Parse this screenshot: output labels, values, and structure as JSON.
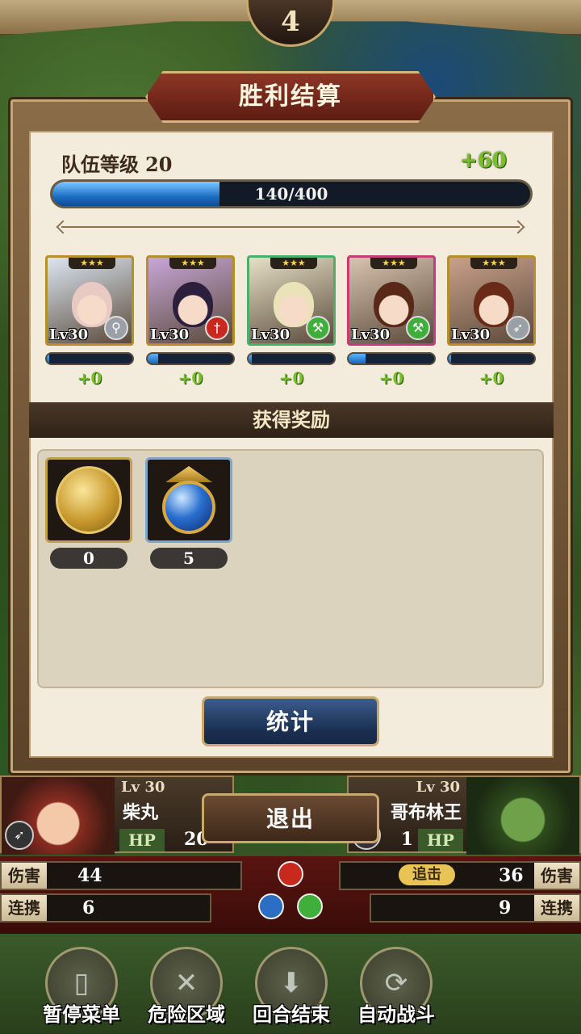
{
  "turn": {
    "number": "4"
  },
  "result": {
    "title": "胜利结算",
    "party_level_label": "队伍等级",
    "party_level": "20",
    "exp_gain": "+60",
    "exp_text": "140/400",
    "exp_progress": 0.35,
    "characters": [
      {
        "level": "Lv30",
        "stars": "★★★",
        "weapon_icon": "staff-icon",
        "weapon_color": "#9aa0a6",
        "frame_color": "#b88d2e",
        "bg_color": "#dbe6f2",
        "hair_color": "#e8c9c4",
        "bar_progress": 0.03,
        "gain": "+0"
      },
      {
        "level": "Lv30",
        "stars": "★★★",
        "weapon_icon": "sword-icon",
        "weapon_color": "#c8281e",
        "frame_color": "#b88d2e",
        "bg_color": "#c8a6d8",
        "hair_color": "#2c1f3e",
        "bar_progress": 0.12,
        "gain": "+0"
      },
      {
        "level": "Lv30",
        "stars": "★★★",
        "weapon_icon": "axe-icon",
        "weapon_color": "#3fae3a",
        "frame_color": "#48b06a",
        "bg_color": "#e6e0c6",
        "hair_color": "#eae2b8",
        "bar_progress": 0.04,
        "gain": "+0"
      },
      {
        "level": "Lv30",
        "stars": "★★★",
        "weapon_icon": "axe-icon",
        "weapon_color": "#3fae3a",
        "frame_color": "#c43c7a",
        "bg_color": "#d9c3b0",
        "hair_color": "#5a2818",
        "bar_progress": 0.2,
        "gain": "+0"
      },
      {
        "level": "Lv30",
        "stars": "★★★",
        "weapon_icon": "bow-icon",
        "weapon_color": "#9aa0a6",
        "frame_color": "#b88d2e",
        "bg_color": "#c9a08a",
        "hair_color": "#6a2a18",
        "bar_progress": 0.03,
        "gain": "+0"
      }
    ],
    "rewards_title": "获得奖励",
    "rewards": [
      {
        "icon": "gold-medal-icon",
        "count": "0"
      },
      {
        "icon": "blue-orb-icon",
        "count": "5"
      }
    ],
    "stats_button": "统计",
    "exit_button": "退出"
  },
  "battle": {
    "player": {
      "level": "Lv 30",
      "name": "柴丸",
      "hp_label": "HP",
      "hp": "20"
    },
    "enemy": {
      "level": "Lv 30",
      "name": "哥布林王",
      "hp_label": "HP",
      "hp": "1"
    },
    "left_stats": [
      {
        "label": "伤害",
        "value": "44"
      },
      {
        "label": "连携",
        "value": "6"
      }
    ],
    "right_stats": [
      {
        "label": "伤害",
        "value": "36",
        "tag": "追击"
      },
      {
        "label": "连携",
        "value": "9"
      }
    ]
  },
  "menu": [
    {
      "label": "暂停菜单",
      "icon": "book-icon"
    },
    {
      "label": "危险区域",
      "icon": "crossed-swords-icon"
    },
    {
      "label": "回合结束",
      "icon": "arrow-down-icon"
    },
    {
      "label": "自动战斗",
      "icon": "refresh-icon"
    }
  ]
}
